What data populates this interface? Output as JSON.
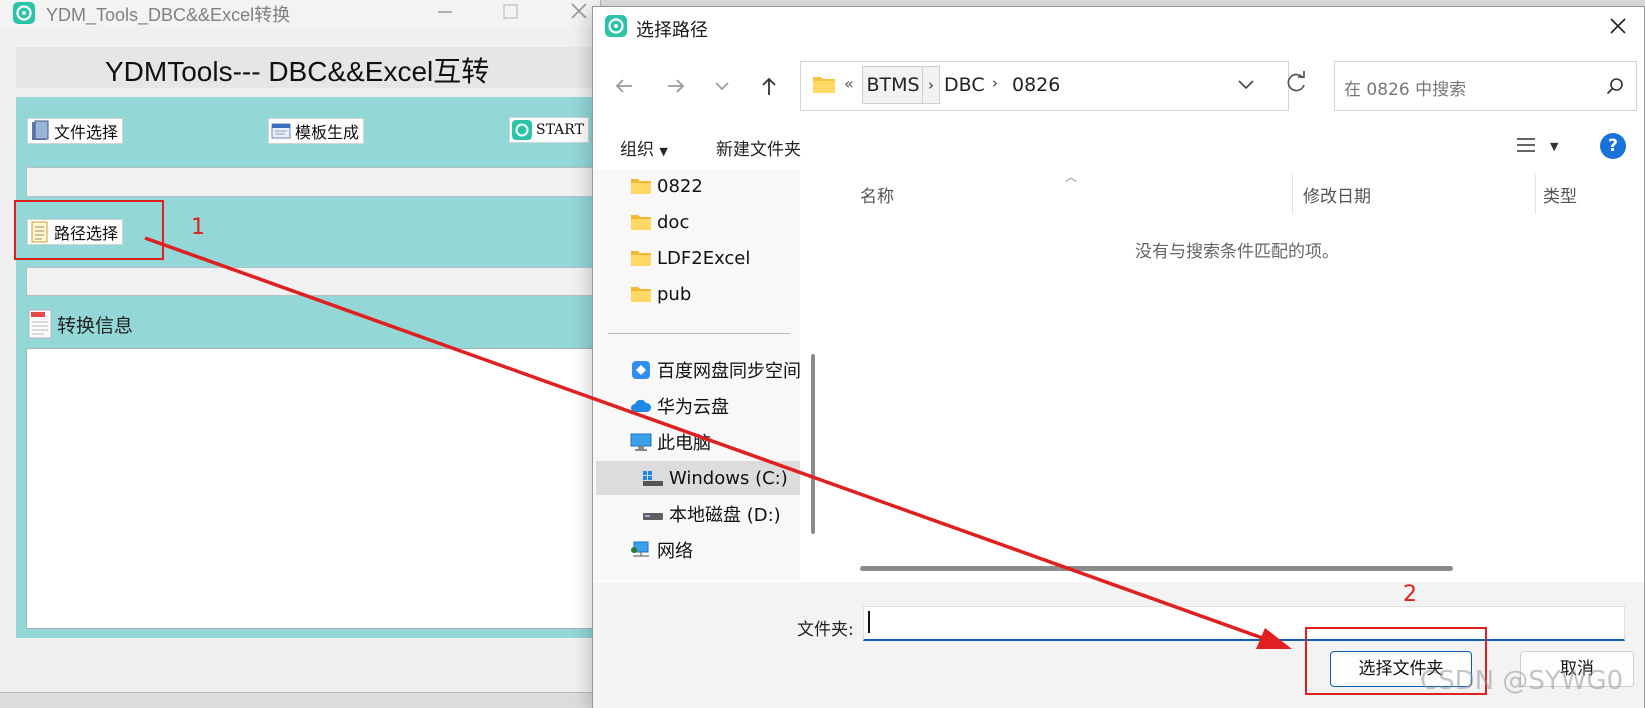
{
  "app_window": {
    "title": "YDM_Tools_DBC&&Excel转换",
    "heading": "YDMTools--- DBC&&Excel互转",
    "buttons": {
      "file_select": "文件选择",
      "template_generate": "模板生成",
      "start": "START",
      "path_select": "路径选择"
    },
    "file_path_value": "",
    "dir_path_value": "",
    "info_label": "转换信息",
    "info_text": "",
    "teal_color": "#93d7d7"
  },
  "dialog": {
    "title": "选择路径",
    "breadcrumb": [
      "BTMS",
      "DBC",
      "0826"
    ],
    "breadcrumb_overflow": "«",
    "search_placeholder": "在 0826 中搜索",
    "commands": {
      "organize": "组织",
      "new_folder": "新建文件夹"
    },
    "nav_tree": [
      {
        "label": "0822",
        "icon": "folder-icon"
      },
      {
        "label": "doc",
        "icon": "folder-icon"
      },
      {
        "label": "LDF2Excel",
        "icon": "folder-icon"
      },
      {
        "label": "pub",
        "icon": "folder-icon"
      },
      {
        "label": "百度网盘同步空间",
        "icon": "baidu-netdisk-icon"
      },
      {
        "label": "华为云盘",
        "icon": "cloud-icon"
      },
      {
        "label": "此电脑",
        "icon": "computer-icon"
      },
      {
        "label": "Windows (C:)",
        "icon": "windows-drive-icon",
        "selected": true
      },
      {
        "label": "本地磁盘 (D:)",
        "icon": "drive-icon"
      },
      {
        "label": "网络",
        "icon": "network-icon"
      }
    ],
    "columns": [
      "名称",
      "修改日期",
      "类型"
    ],
    "empty_message": "没有与搜索条件匹配的项。",
    "folder_label": "文件夹:",
    "folder_value": "",
    "select_button": "选择文件夹",
    "cancel_button": "取消",
    "accent_color": "#0a5fb4"
  },
  "annotations": {
    "step1": "1",
    "step2": "2",
    "color": "#e02020"
  },
  "watermark": "CSDN @SYWG0"
}
